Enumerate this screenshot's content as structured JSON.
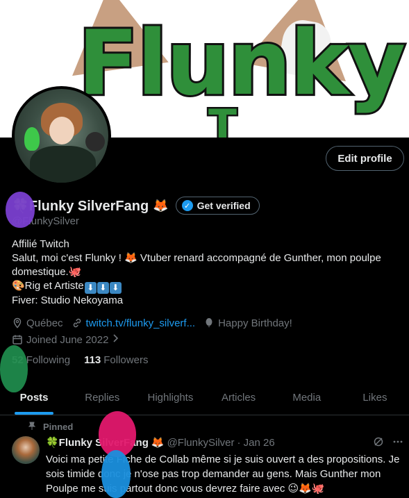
{
  "banner": {
    "logo_text": "Flunky",
    "logo_sub": "T"
  },
  "profile": {
    "edit_label": "Edit profile",
    "display_name": "🍀Flunky SilverFang",
    "name_emoji": "🦊",
    "verify_label": "Get verified",
    "handle": "@FlunkySilver",
    "bio": {
      "line1": "Affilié Twitch",
      "line2": "Salut, moi c'est Flunky ! 🦊 Vtuber renard accompagné de Gunther, mon poulpe",
      "line3": "domestique.🐙",
      "line4": "🎨Rig et Artiste",
      "line4_arrows": [
        "⬇",
        "⬇",
        "⬇"
      ],
      "line5": "Fiver: Studio Nekoyama"
    },
    "location": "Québec",
    "website": "twitch.tv/flunky_silverf...",
    "birthday": "Happy Birthday!",
    "joined": "Joined June 2022",
    "following_count": "52",
    "following_label": "Following",
    "followers_count": "113",
    "followers_label": "Followers"
  },
  "tabs": [
    {
      "label": "Posts"
    },
    {
      "label": "Replies"
    },
    {
      "label": "Highlights"
    },
    {
      "label": "Articles"
    },
    {
      "label": "Media"
    },
    {
      "label": "Likes"
    }
  ],
  "post": {
    "pinned_label": "Pinned",
    "author_name": "🍀Flunky SilverFang",
    "author_emoji": "🦊",
    "author_handle": "@FlunkySilver",
    "date": "· Jan 26",
    "text": "Voici ma petite Fiche de Collab même si je suis ouvert a des propositions. Je sois timide donc je n'ose pas trop demander au gens. Mais Gunther mon Poulpe me suis partout donc vous devrez faire avec 😉🦊🐙"
  },
  "colors": {
    "accent": "#1d9bf0",
    "muted": "#71767b",
    "text": "#e7e9ea",
    "border": "#536471"
  },
  "icons": [
    "location-icon",
    "link-icon",
    "balloon-icon",
    "calendar-icon",
    "pin-icon",
    "grok-icon",
    "more-icon",
    "verified-badge-icon"
  ]
}
